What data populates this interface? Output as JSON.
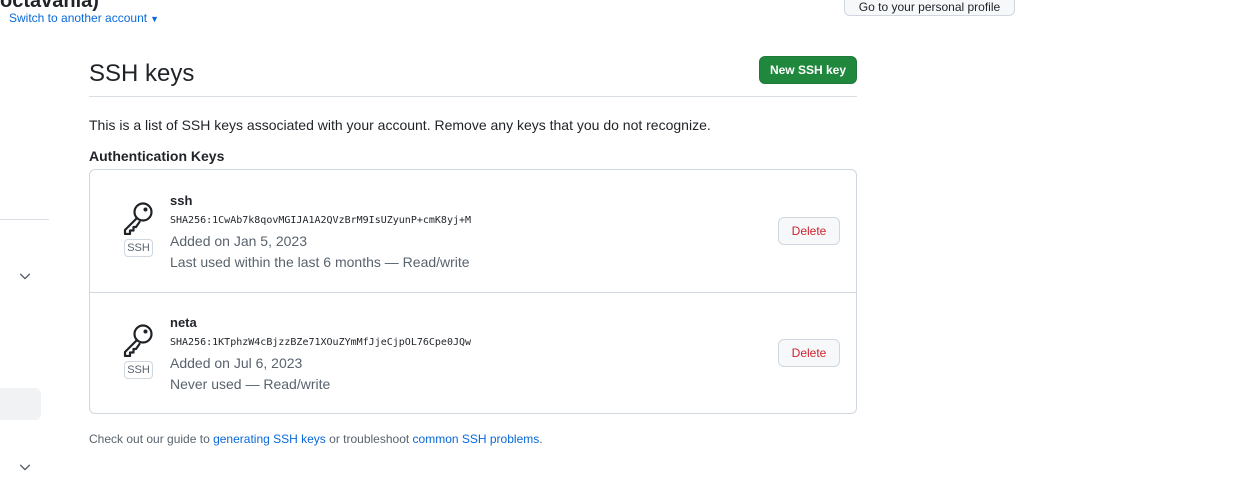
{
  "header": {
    "account_name_partial": "octavania)",
    "switch_account": "Switch to another account",
    "profile_button": "Go to your personal profile"
  },
  "page": {
    "title": "SSH keys",
    "new_key_button": "New SSH key",
    "intro": "This is a list of SSH keys associated with your account. Remove any keys that you do not recognize.",
    "section_heading": "Authentication Keys"
  },
  "keys": [
    {
      "name": "ssh",
      "fingerprint": "SHA256:1CwAb7k8qovMGIJA1A2QVzBrM9IsUZyunP+cmK8yj+M",
      "added": "Added on Jan 5, 2023",
      "usage": "Last used within the last 6 months — Read/write",
      "badge": "SSH",
      "delete_label": "Delete"
    },
    {
      "name": "neta",
      "fingerprint": "SHA256:1KTphzW4cBjzzBZe71XOuZYmMfJjeCjpOL76Cpe0JQw",
      "added": "Added on Jul 6, 2023",
      "usage": "Never used — Read/write",
      "badge": "SSH",
      "delete_label": "Delete"
    }
  ],
  "footer": {
    "prefix": "Check out our guide to ",
    "link1": "generating SSH keys",
    "middle": " or troubleshoot ",
    "link2": "common SSH problems",
    "suffix": "."
  },
  "colors": {
    "primary_button": "#1f883d",
    "link": "#0969da",
    "danger": "#cf222e"
  },
  "icons": [
    "key-icon",
    "chevron-down-icon",
    "caret-down-icon"
  ]
}
